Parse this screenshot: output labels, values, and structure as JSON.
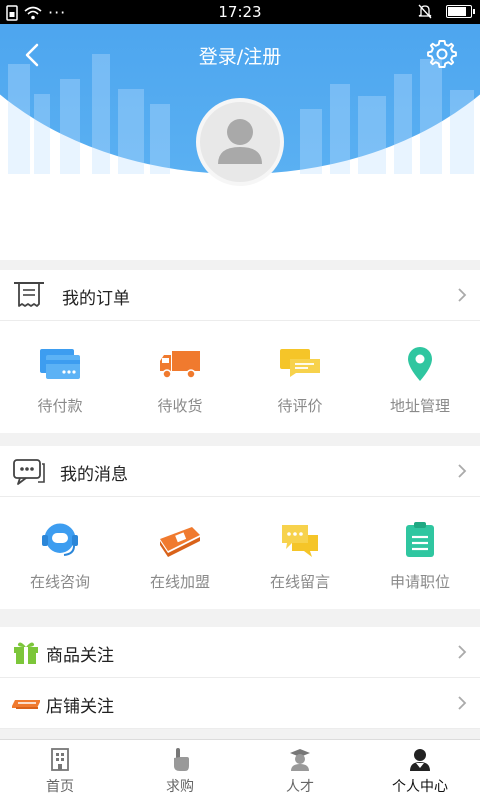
{
  "status_bar": {
    "time": "17:23",
    "dots": "···"
  },
  "header": {
    "title": "登录/注册"
  },
  "orders": {
    "title": "我的订单",
    "items": [
      {
        "label": "待付款",
        "icon": "card-icon"
      },
      {
        "label": "待收货",
        "icon": "truck-icon"
      },
      {
        "label": "待评价",
        "icon": "comment-icon"
      },
      {
        "label": "地址管理",
        "icon": "location-pin-icon"
      }
    ]
  },
  "messages": {
    "title": "我的消息",
    "items": [
      {
        "label": "在线咨询",
        "icon": "headset-icon"
      },
      {
        "label": "在线加盟",
        "icon": "money-stack-icon"
      },
      {
        "label": "在线留言",
        "icon": "chat-bubbles-icon"
      },
      {
        "label": "申请职位",
        "icon": "clipboard-icon"
      }
    ]
  },
  "follows": [
    {
      "label": "商品关注",
      "icon": "gift-icon"
    },
    {
      "label": "店铺关注",
      "icon": "shop-awning-icon"
    }
  ],
  "tabs": [
    {
      "label": "首页",
      "icon": "building-icon"
    },
    {
      "label": "求购",
      "icon": "hand-pointer-icon"
    },
    {
      "label": "人才",
      "icon": "graduate-icon"
    },
    {
      "label": "个人中心",
      "icon": "person-icon"
    }
  ],
  "colors": {
    "header_blue": "#3a8fe0",
    "card_blue": "#3d9df0",
    "truck_orange": "#f07a2e",
    "comment_yellow": "#f5c528",
    "pin_green": "#2fc6a0",
    "headset_blue": "#3d9df0",
    "gift_green": "#7cc63a",
    "shop_orange": "#f07a2e"
  }
}
